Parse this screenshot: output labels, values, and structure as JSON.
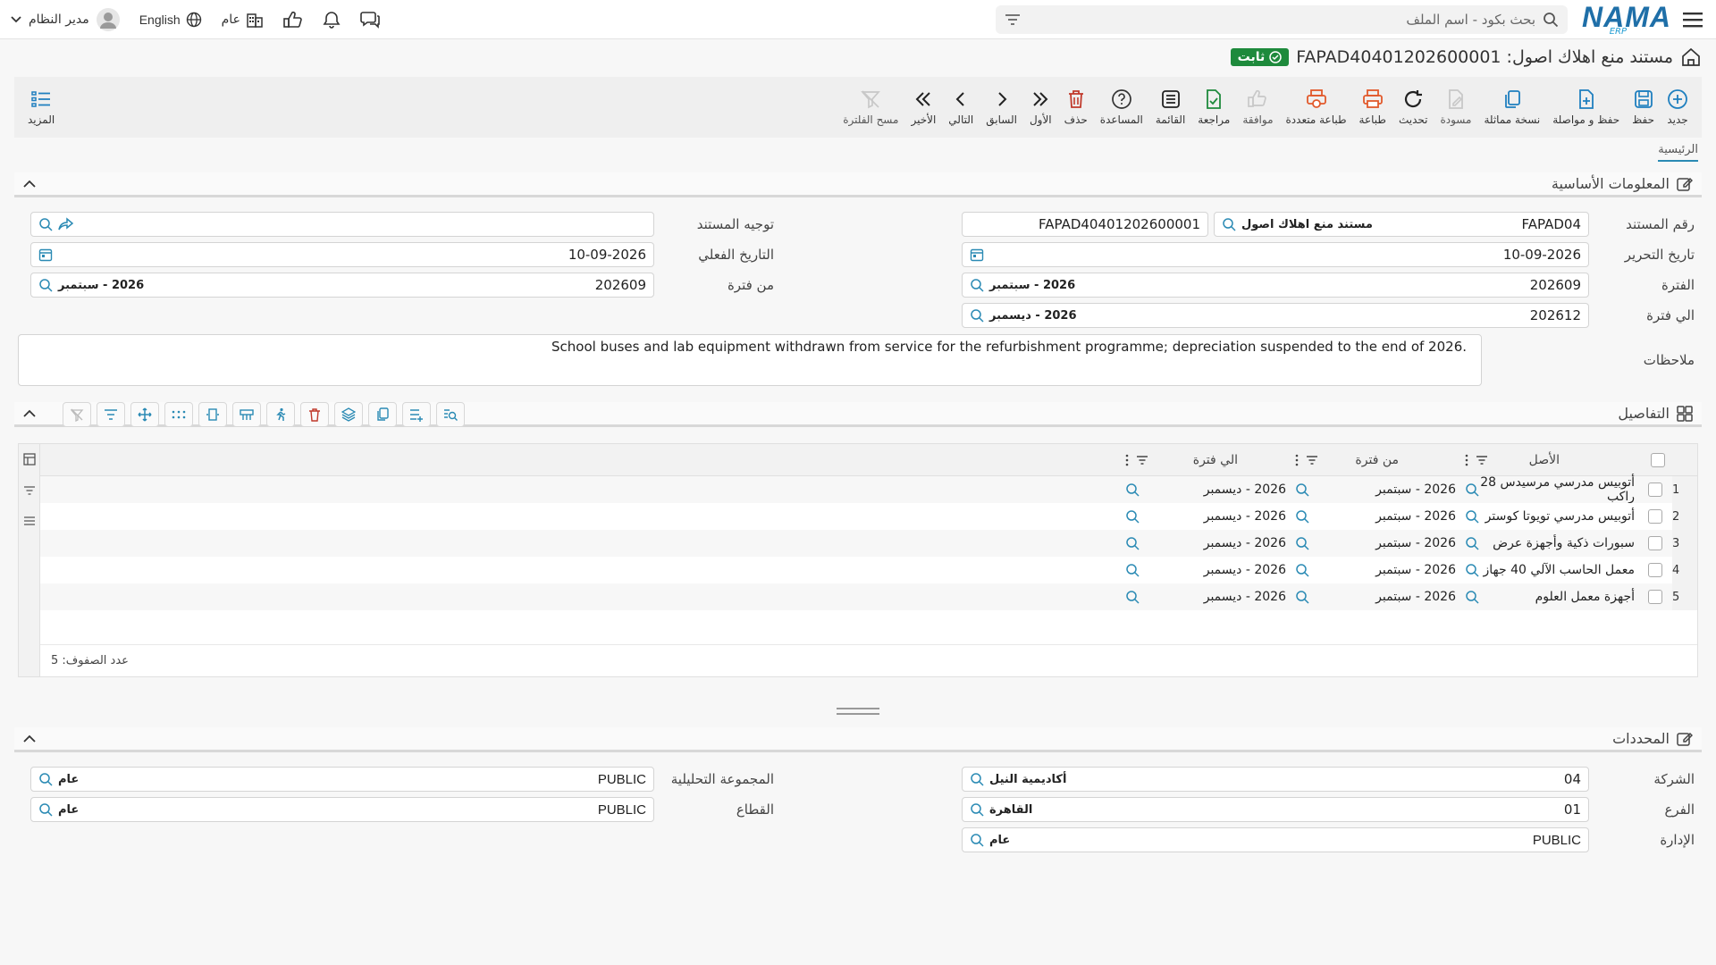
{
  "topbar": {
    "search_placeholder": "بحث بكود - اسم الملف",
    "logo_main": "NAMA",
    "logo_sub": "ERP",
    "user_name": "مدير النظام",
    "language": "English",
    "scope": "عام"
  },
  "title": {
    "text": "مستند منع اهلاك اصول: FAPAD40401202600001",
    "status": "ثابت"
  },
  "toolbar": {
    "new": "جديد",
    "save": "حفظ",
    "save_continue": "حفظ و مواصلة",
    "copy": "نسخة مماثلة",
    "draft": "مسودة",
    "refresh": "تحديث",
    "print": "طباعة",
    "multi_print": "طباعة متعددة",
    "approve": "موافقة",
    "review": "مراجعة",
    "list": "القائمة",
    "help": "المساعدة",
    "delete": "حذف",
    "first": "الأول",
    "previous": "السابق",
    "next": "التالي",
    "last": "الأخير",
    "clear_filter": "مسح الفلترة",
    "more": "المزيد"
  },
  "breadcrumb": "الرئيسية",
  "basic_info": {
    "title": "المعلومات الأساسية",
    "doc_number_label": "رقم المستند",
    "doc_number_code": "FAPAD04",
    "doc_type_name": "مستند منع اهلاك اصول",
    "doc_full_number": "FAPAD40401202600001",
    "doc_direction_label": "توجيه المستند",
    "doc_direction_value": "",
    "issue_date_label": "تاريخ التحرير",
    "issue_date": "10-09-2026",
    "actual_date_label": "التاريخ الفعلي",
    "actual_date": "10-09-2026",
    "period_label": "الفترة",
    "period_code": "202609",
    "period_name": "2026 - سبتمبر",
    "from_period_label": "من فترة",
    "from_period_code": "202609",
    "from_period_name": "2026 - سبتمبر",
    "to_period_label": "الي فترة",
    "to_period_code": "202612",
    "to_period_name": "2026 - ديسمبر",
    "notes_label": "ملاحظات",
    "notes": "School buses and lab equipment withdrawn from service for the refurbishment programme; depreciation suspended to the end of 2026."
  },
  "details": {
    "title": "التفاصيل",
    "columns": {
      "asset": "الأصل",
      "from_period": "من فترة",
      "to_period": "الي فترة"
    },
    "rows": [
      {
        "num": "1",
        "asset": "أتوبيس مدرسي مرسيدس 28 راكب",
        "from": "2026 - سبتمبر",
        "to": "2026 - ديسمبر"
      },
      {
        "num": "2",
        "asset": "أتوبيس مدرسي تويوتا كوستر",
        "from": "2026 - سبتمبر",
        "to": "2026 - ديسمبر"
      },
      {
        "num": "3",
        "asset": "سبورات ذكية وأجهزة عرض",
        "from": "2026 - سبتمبر",
        "to": "2026 - ديسمبر"
      },
      {
        "num": "4",
        "asset": "معمل الحاسب الآلي 40 جهاز",
        "from": "2026 - سبتمبر",
        "to": "2026 - ديسمبر"
      },
      {
        "num": "5",
        "asset": "أجهزة معمل العلوم",
        "from": "2026 - سبتمبر",
        "to": "2026 - ديسمبر"
      }
    ],
    "row_count_label": "عدد الصفوف: 5"
  },
  "dimensions": {
    "title": "المحددات",
    "company_label": "الشركة",
    "company_code": "04",
    "company_name": "أكاديمية النيل",
    "branch_label": "الفرع",
    "branch_code": "01",
    "branch_name": "القاهرة",
    "department_label": "الإدارة",
    "department_code": "PUBLIC",
    "department_name": "عام",
    "analytic_label": "المجموعة التحليلية",
    "analytic_code": "PUBLIC",
    "analytic_name": "عام",
    "sector_label": "القطاع",
    "sector_code": "PUBLIC",
    "sector_name": "عام"
  },
  "colors": {
    "accent": "#2a8ab4",
    "status_green": "#1e8a3c",
    "danger": "#c0392b",
    "print_orange": "#e2592b"
  }
}
